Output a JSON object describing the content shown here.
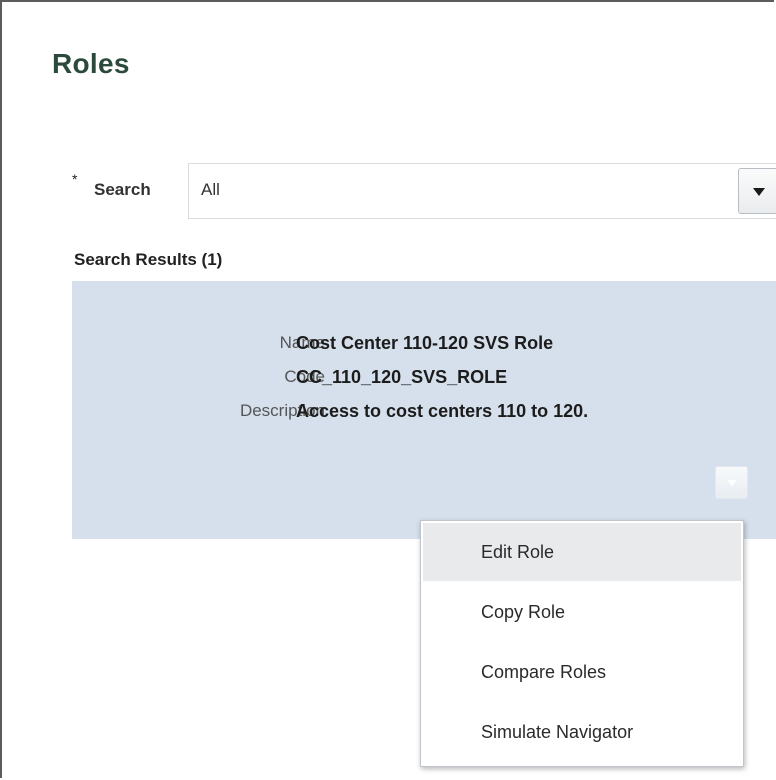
{
  "page": {
    "title": "Roles"
  },
  "search": {
    "required_marker": "*",
    "label": "Search",
    "selected_value": "All"
  },
  "results": {
    "header": "Search Results (1)",
    "items": [
      {
        "name_label": "Name",
        "name": "Cost Center 110-120 SVS Role",
        "code_label": "Code",
        "code": "CC_110_120_SVS_ROLE",
        "description_label": "Description",
        "description": "Access to cost centers 110 to 120."
      }
    ]
  },
  "actions_menu": {
    "items": [
      {
        "label": "Edit Role",
        "highlighted": true
      },
      {
        "label": "Copy Role",
        "highlighted": false
      },
      {
        "label": "Compare Roles",
        "highlighted": false
      },
      {
        "label": "Simulate Navigator",
        "highlighted": false
      }
    ]
  },
  "colors": {
    "title": "#2c4a3c",
    "result_card_bg": "#d5e0ec",
    "menu_hover_bg": "#e9eaeb"
  },
  "icons": {
    "search_dropdown": "chevron-down-icon",
    "actions_dropdown": "chevron-down-icon"
  }
}
